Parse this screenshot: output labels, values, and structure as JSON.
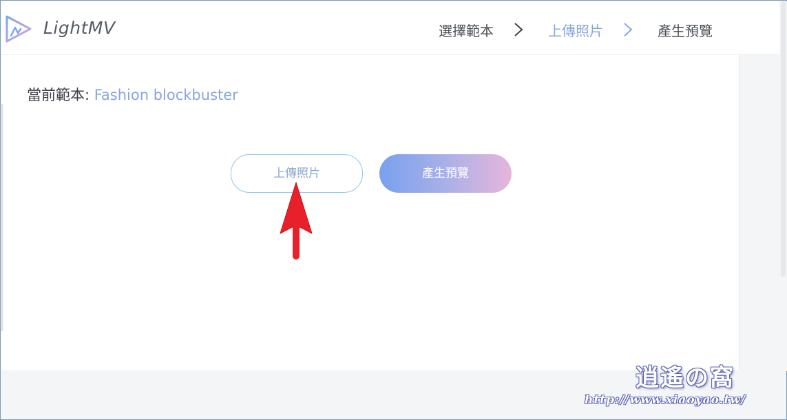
{
  "header": {
    "brand": "LightMV",
    "steps": [
      {
        "label": "選擇範本",
        "active": false
      },
      {
        "label": "上傳照片",
        "active": true
      },
      {
        "label": "產生預覽",
        "active": false
      }
    ]
  },
  "main": {
    "template_prefix": "當前範本: ",
    "template_name": "Fashion blockbuster",
    "upload_button": "上傳照片",
    "preview_button": "產生預覽"
  },
  "watermark": {
    "title": "逍遙の窩",
    "url": "http://www.xiaoyao.tw/"
  },
  "colors": {
    "accent": "#86a7de",
    "upload_border": "#8fc7e8",
    "gradient_start": "#78a0ee",
    "gradient_end": "#e6b6dc",
    "annotation_arrow": "#e8202a"
  },
  "icons": {
    "logo": "lightmv-logo-icon",
    "step_separator": "chevron-right-icon",
    "annotation": "arrow-up-icon"
  }
}
